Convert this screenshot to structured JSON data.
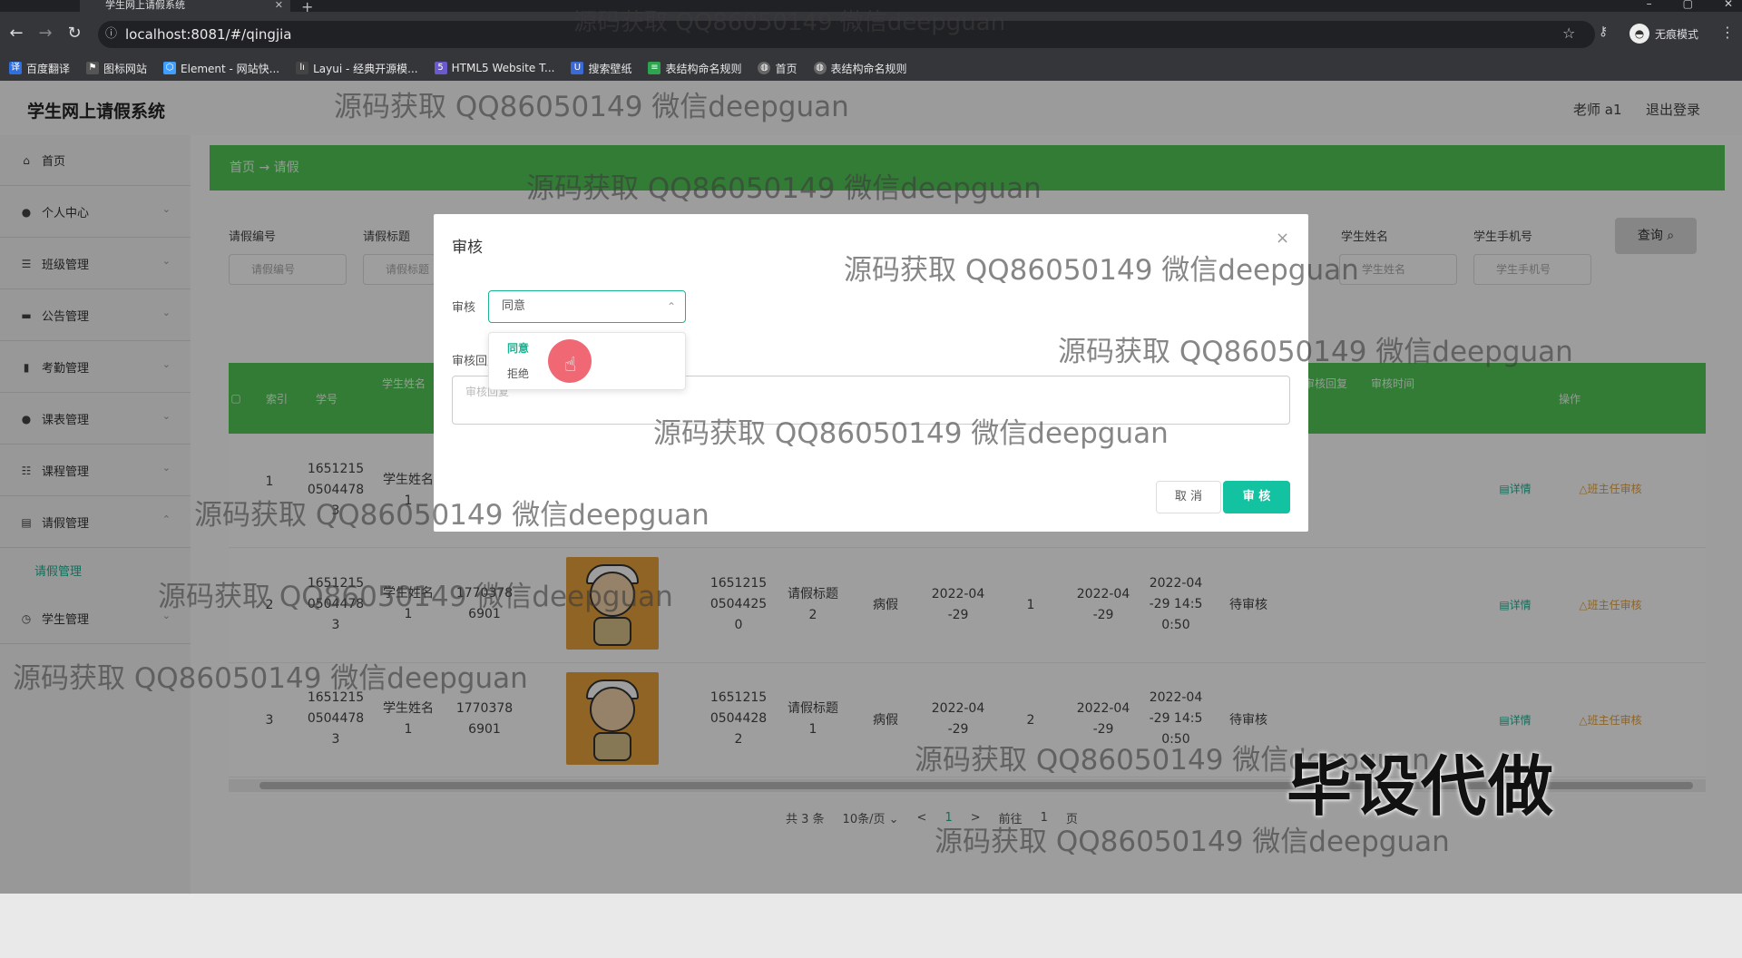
{
  "browser": {
    "tab_title": "学生网上请假系统",
    "url": "localhost:8081/#/qingjia",
    "profile_label": "无痕模式",
    "bookmarks": [
      "百度翻译",
      "图标网站",
      "Element - 网站快...",
      "Layui - 经典开源模...",
      "HTML5 Website T...",
      "搜索壁纸",
      "表结构命名规则",
      "首页",
      "表结构命名规则"
    ]
  },
  "app": {
    "title": "学生网上请假系统",
    "user_label": "老师 a1",
    "logout_label": "退出登录"
  },
  "sidebar": {
    "items": [
      {
        "label": "首页",
        "icon": "home-icon"
      },
      {
        "label": "个人中心",
        "icon": "user-icon"
      },
      {
        "label": "班级管理",
        "icon": "list-icon"
      },
      {
        "label": "公告管理",
        "icon": "notice-icon"
      },
      {
        "label": "考勤管理",
        "icon": "chart-icon"
      },
      {
        "label": "课表管理",
        "icon": "user-icon"
      },
      {
        "label": "课程管理",
        "icon": "sliders-icon"
      },
      {
        "label": "请假管理",
        "icon": "doc-icon"
      },
      {
        "label": "学生管理",
        "icon": "clock-icon"
      }
    ],
    "subitem": "请假管理"
  },
  "breadcrumb": {
    "home": "首页",
    "arrow": "→",
    "current": "请假"
  },
  "filters": {
    "labels": [
      "请假编号",
      "请假标题",
      "学生姓名",
      "学生手机号"
    ],
    "placeholders": [
      "请假编号",
      "请假标题",
      "学生姓名",
      "学生手机号"
    ],
    "query_label": "查询"
  },
  "table": {
    "headers": [
      "索引",
      "学号",
      "学生姓名",
      "审核回复",
      "审核时间",
      "操作"
    ],
    "rows": [
      {
        "index": "1",
        "xuehao": "1651215\n0504478\n3",
        "name": "学生姓名\n1",
        "phone": "",
        "leave_no": "",
        "leave_title": "",
        "type": "",
        "days": "",
        "date": "",
        "apply_time": "",
        "status": ""
      },
      {
        "index": "2",
        "xuehao": "1651215\n0504478\n3",
        "name": "学生姓名\n1",
        "phone": "1770378\n6901",
        "leave_no": "1651215\n0504425\n0",
        "leave_title": "请假标题\n2",
        "type": "病假",
        "days": "1",
        "date1": "2022-04\n-29",
        "date2": "2022-04\n-29",
        "apply_time": "2022-04\n-29 14:5\n0:50",
        "status": "待审核"
      },
      {
        "index": "3",
        "xuehao": "1651215\n0504478\n3",
        "name": "学生姓名\n1",
        "phone": "1770378\n6901",
        "leave_no": "1651215\n0504428\n2",
        "leave_title": "请假标题\n1",
        "type": "病假",
        "days": "2",
        "date1": "2022-04\n-29",
        "date2": "2022-04\n-29",
        "apply_time": "2022-04\n-29 14:5\n0:50",
        "status": "待审核"
      }
    ],
    "op_detail": "详情",
    "op_review": "班主任审核"
  },
  "pagination": {
    "total": "共 3 条",
    "page_size": "10条/页",
    "prev": "<",
    "current": "1",
    "next": ">",
    "goto": "前往",
    "goto_val": "1",
    "page_suffix": "页"
  },
  "dialog": {
    "title": "审核",
    "audit_label": "审核",
    "selected": "同意",
    "reply_label": "审核回复",
    "reply_placeholder": "审核回复",
    "options": [
      "同意",
      "拒绝"
    ],
    "cancel": "取 消",
    "confirm": "审 核"
  },
  "watermarks": {
    "text": "源码获取 QQ86050149 微信deepguan",
    "banner": "毕设代做"
  }
}
